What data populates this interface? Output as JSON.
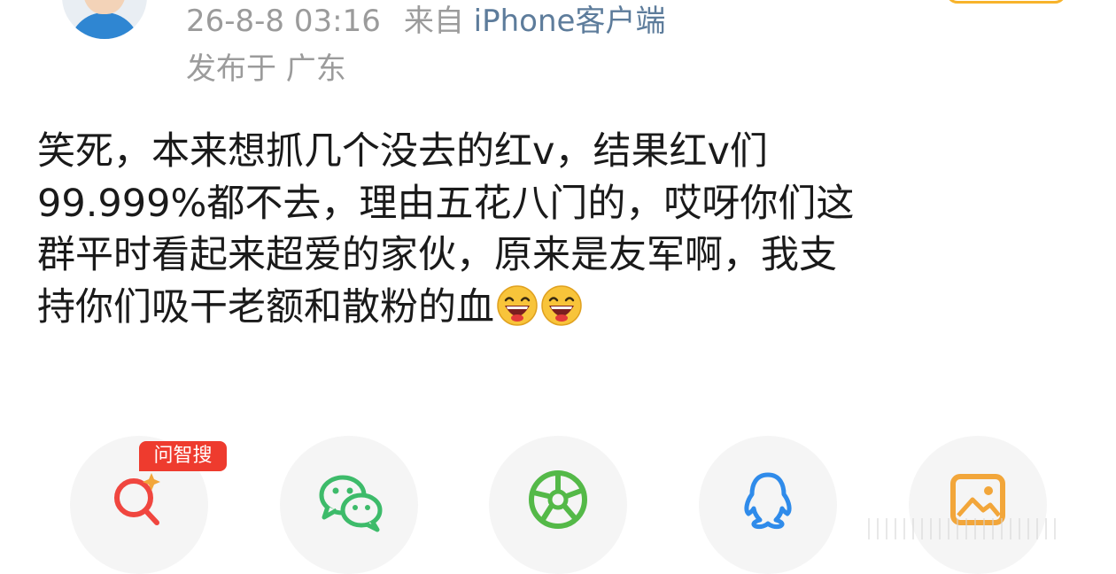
{
  "post": {
    "timestamp": "26-8-8 03:16",
    "source_prefix": "来自",
    "source_name": "iPhone客户端",
    "location": "发布于 广东",
    "lines": [
      "笑死，本来想抓几个没去的红v，结果红v们",
      "99.999%都不去，理由五花八门的，哎呀你们这",
      "群平时看起来超爱的家伙，原来是友军啊，我支",
      "持你们吸干老额和散粉的血"
    ],
    "emojis": [
      "laughing-face-icon",
      "laughing-face-icon"
    ]
  },
  "share": {
    "badge": "问智搜",
    "buttons": [
      {
        "icon": "ai-search-icon",
        "color": "#f0463f"
      },
      {
        "icon": "wechat-icon",
        "color": "#3dbb6a"
      },
      {
        "icon": "moments-icon",
        "color": "#54b948"
      },
      {
        "icon": "qq-icon",
        "color": "#2f8bea"
      },
      {
        "icon": "image-icon",
        "color": "#f2a63a"
      }
    ]
  },
  "colors": {
    "meta_text": "#9b9b9b",
    "source_link": "#5d7c9b",
    "body_text": "#1a1a1a",
    "badge_bg": "#ee3b2e",
    "follow_border": "#f7b32b"
  }
}
